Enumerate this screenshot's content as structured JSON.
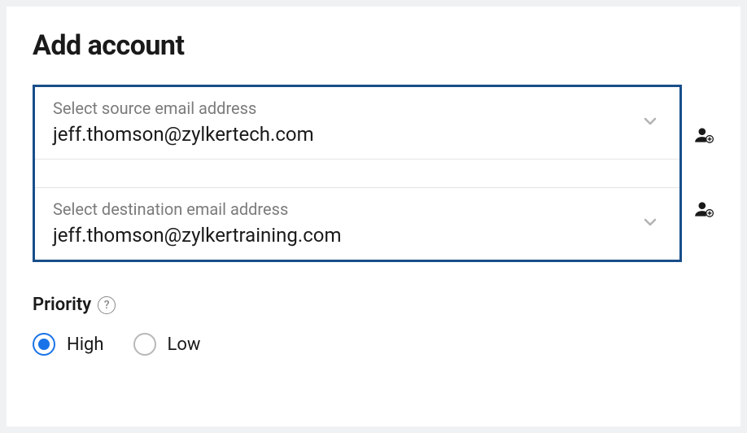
{
  "title": "Add account",
  "source": {
    "label": "Select source email address",
    "value": "jeff.thomson@zylkertech.com"
  },
  "destination": {
    "label": "Select destination email address",
    "value": "jeff.thomson@zylkertraining.com"
  },
  "priority": {
    "label": "Priority",
    "options": [
      {
        "label": "High",
        "selected": true
      },
      {
        "label": "Low",
        "selected": false
      }
    ]
  }
}
